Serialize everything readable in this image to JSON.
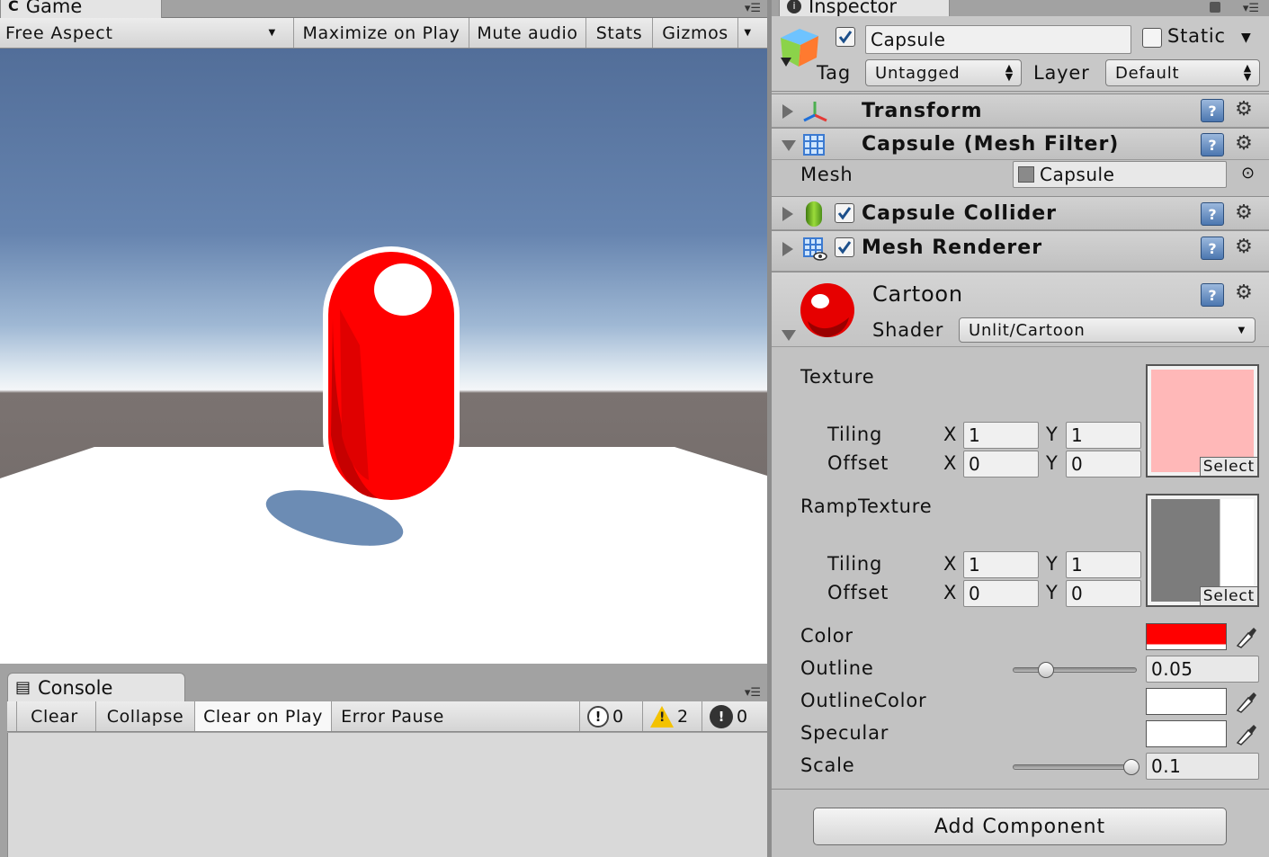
{
  "game": {
    "tab_label": "Game",
    "aspect": "Free Aspect",
    "buttons": [
      "Maximize on Play",
      "Mute audio",
      "Stats",
      "Gizmos"
    ]
  },
  "console": {
    "tab_label": "Console",
    "buttons": [
      "Clear",
      "Collapse",
      "Clear on Play",
      "Error Pause"
    ],
    "info_count": "0",
    "warning_count": "2",
    "error_count": "0"
  },
  "inspector": {
    "tab_label": "Inspector",
    "object_name": "Capsule",
    "static_label": "Static",
    "tag_label": "Tag",
    "tag_value": "Untagged",
    "layer_label": "Layer",
    "layer_value": "Default",
    "components": {
      "transform": "Transform",
      "mesh_filter": "Capsule (Mesh Filter)",
      "mesh_label": "Mesh",
      "mesh_value": "Capsule",
      "collider": "Capsule Collider",
      "renderer": "Mesh Renderer"
    },
    "material": {
      "name": "Cartoon",
      "shader_label": "Shader",
      "shader_value": "Unlit/Cartoon",
      "texture": {
        "label": "Texture",
        "tiling_label": "Tiling",
        "offset_label": "Offset",
        "tiling_x": "1",
        "tiling_y": "1",
        "offset_x": "0",
        "offset_y": "0",
        "select": "Select",
        "preview_color": "#ffb8b8"
      },
      "ramp": {
        "label": "RampTexture",
        "tiling_label": "Tiling",
        "offset_label": "Offset",
        "tiling_x": "1",
        "tiling_y": "1",
        "offset_x": "0",
        "offset_y": "0",
        "select": "Select"
      },
      "x_label": "X",
      "y_label": "Y",
      "color_label": "Color",
      "color_value": "#ff0000",
      "outline_label": "Outline",
      "outline_value": "0.05",
      "outline_slider_fraction": 0.27,
      "outline_color_label": "OutlineColor",
      "outline_color_value": "#ffffff",
      "specular_label": "Specular",
      "specular_value": "#ffffff",
      "scale_label": "Scale",
      "scale_value": "0.1",
      "scale_slider_fraction": 0.96
    },
    "add_component": "Add Component"
  }
}
